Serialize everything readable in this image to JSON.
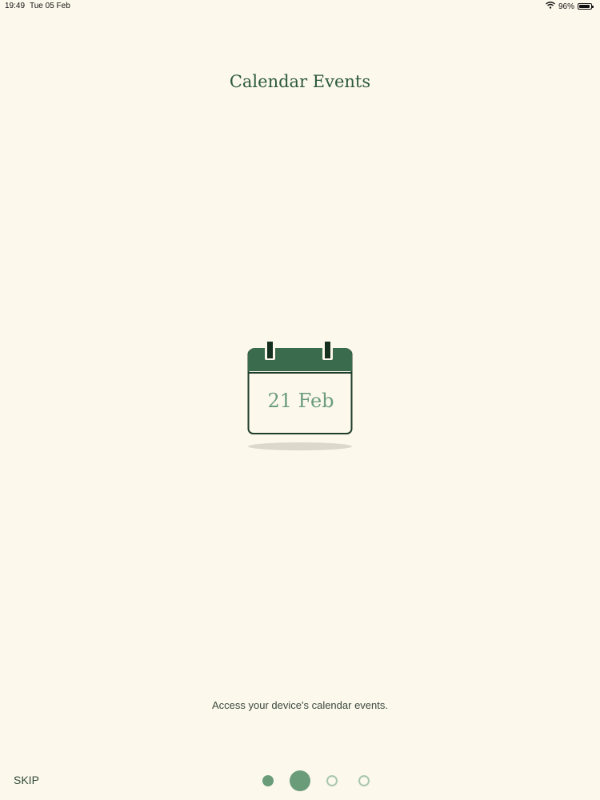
{
  "status_bar": {
    "time": "19:49",
    "date": "Tue 05 Feb",
    "battery": "96%",
    "battery_level": 0.96
  },
  "onboarding": {
    "title": "Calendar Events",
    "calendar_date": "21 Feb",
    "description": "Access your device's calendar events.",
    "skip_label": "SKIP",
    "pager": {
      "page_count": 4,
      "current_page": 2
    }
  },
  "colors": {
    "background": "#fdf8ec",
    "title": "#2c5a3e",
    "accent": "#6a9c7a",
    "calendar_header": "#3a6b4c",
    "inactive_dot": "#a8c7b0"
  },
  "icons": {
    "wifi": "wifi-icon",
    "battery": "battery-icon",
    "calendar": "calendar-icon"
  }
}
